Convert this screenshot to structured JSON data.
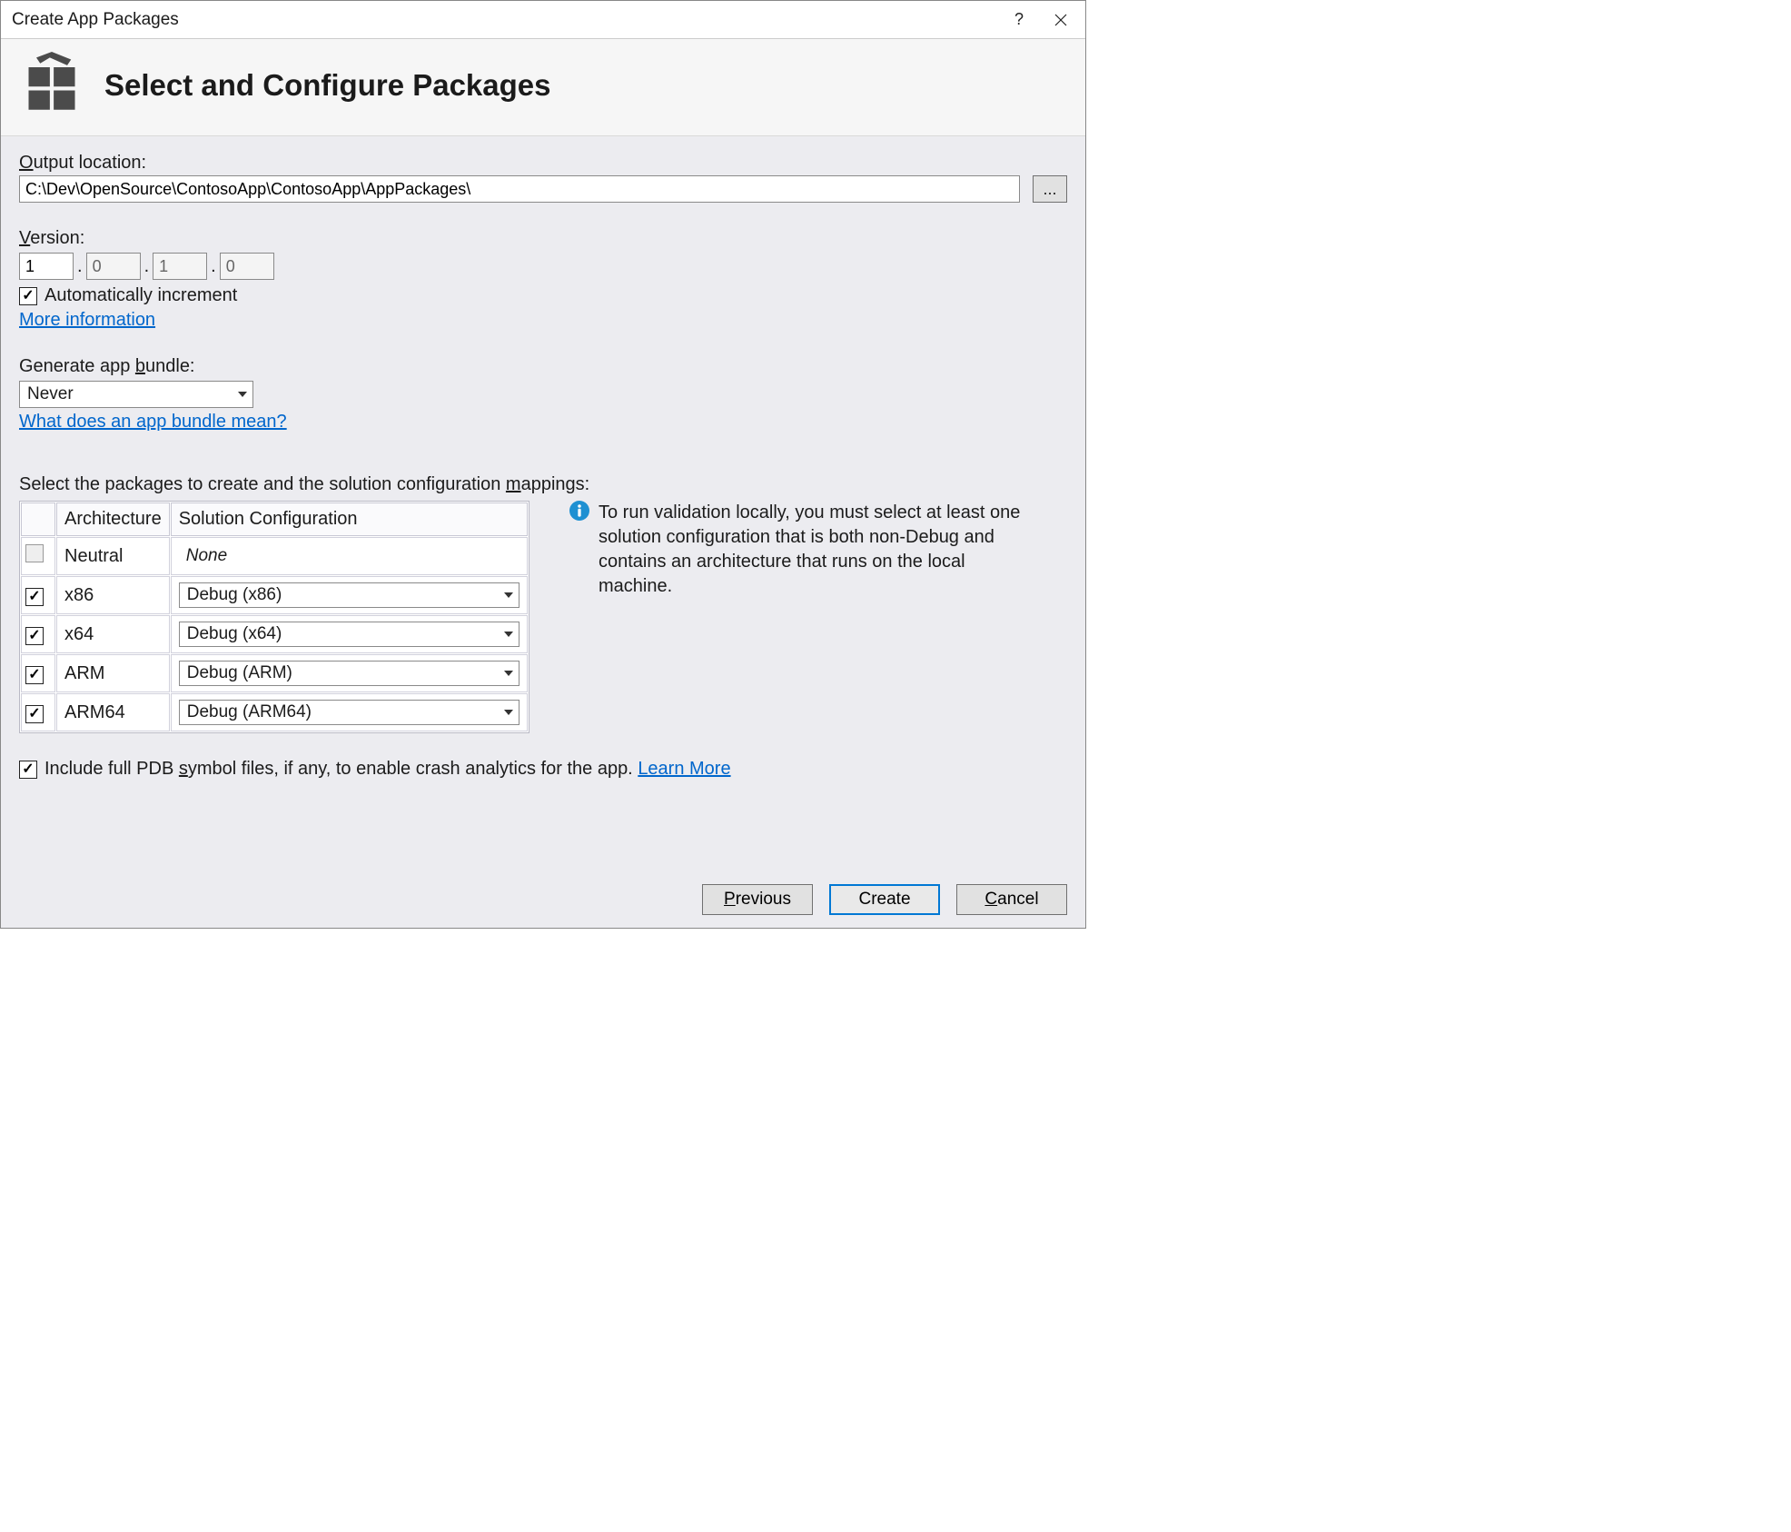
{
  "window": {
    "title": "Create App Packages",
    "help": "?",
    "close": "×"
  },
  "header": {
    "title": "Select and Configure Packages"
  },
  "output": {
    "label": "Output location:",
    "accesskey": "O",
    "value": "C:\\Dev\\OpenSource\\ContosoApp\\ContosoApp\\AppPackages\\",
    "browse": "..."
  },
  "version": {
    "label": "Version:",
    "accesskey": "V",
    "major": "1",
    "minor": "0",
    "build": "1",
    "revision": "0",
    "auto_checked": true,
    "auto_label": "Automatically increment",
    "more_info": "More information"
  },
  "bundle": {
    "label": "Generate app bundle:",
    "accesskey": "b",
    "value": "Never",
    "help_link": "What does an app bundle mean?"
  },
  "packages": {
    "label": "Select the packages to create and the solution configuration mappings:",
    "accesskey": "m",
    "columns": {
      "arch": "Architecture",
      "config": "Solution Configuration"
    },
    "rows": [
      {
        "checked": false,
        "disabled": true,
        "arch": "Neutral",
        "config": "None",
        "italic": true
      },
      {
        "checked": true,
        "disabled": false,
        "arch": "x86",
        "config": "Debug (x86)",
        "italic": false
      },
      {
        "checked": true,
        "disabled": false,
        "arch": "x64",
        "config": "Debug (x64)",
        "italic": false
      },
      {
        "checked": true,
        "disabled": false,
        "arch": "ARM",
        "config": "Debug (ARM)",
        "italic": false
      },
      {
        "checked": true,
        "disabled": false,
        "arch": "ARM64",
        "config": "Debug (ARM64)",
        "italic": false
      }
    ],
    "validation_msg": "To run validation locally, you must select at least one solution configuration that is both non-Debug and contains an architecture that runs on the local machine."
  },
  "pdb": {
    "checked": true,
    "label": "Include full PDB symbol files, if any, to enable crash analytics for the app. ",
    "accesskey": "s",
    "learn_more": "Learn More"
  },
  "footer": {
    "previous": "Previous",
    "previous_key": "P",
    "create": "Create",
    "cancel": "Cancel",
    "cancel_key": "C"
  }
}
